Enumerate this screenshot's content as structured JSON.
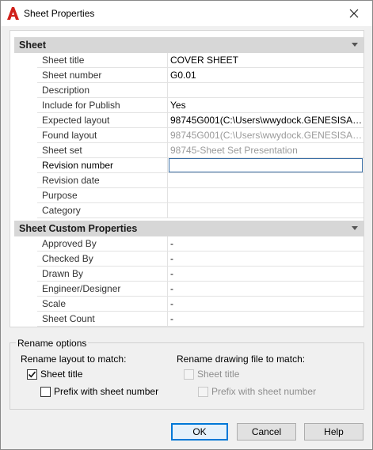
{
  "window": {
    "title": "Sheet Properties"
  },
  "sheet_section": {
    "header": "Sheet",
    "rows": [
      {
        "label": "Sheet title",
        "value": "COVER SHEET"
      },
      {
        "label": "Sheet number",
        "value": "G0.01"
      },
      {
        "label": "Description",
        "value": ""
      },
      {
        "label": "Include for Publish",
        "value": "Yes"
      },
      {
        "label": "Expected layout",
        "value": "98745G001(C:\\Users\\wwydock.GENESISAE..."
      },
      {
        "label": "Found layout",
        "value": "98745G001(C:\\Users\\wwydock.GENESISAE..."
      },
      {
        "label": "Sheet set",
        "value": "98745-Sheet Set Presentation"
      },
      {
        "label": "Revision number",
        "value": ""
      },
      {
        "label": "Revision date",
        "value": ""
      },
      {
        "label": "Purpose",
        "value": ""
      },
      {
        "label": "Category",
        "value": ""
      }
    ]
  },
  "custom_section": {
    "header": "Sheet Custom Properties",
    "rows": [
      {
        "label": "Approved By",
        "value": "-"
      },
      {
        "label": "Checked By",
        "value": "-"
      },
      {
        "label": "Drawn By",
        "value": "-"
      },
      {
        "label": "Engineer/Designer",
        "value": "-"
      },
      {
        "label": "Scale",
        "value": "-"
      },
      {
        "label": "Sheet Count",
        "value": "-"
      }
    ]
  },
  "rename": {
    "legend": "Rename options",
    "layout_heading": "Rename layout to match:",
    "layout_sheet_title": "Sheet title",
    "layout_prefix": "Prefix with sheet number",
    "drawing_heading": "Rename drawing file to match:",
    "drawing_sheet_title": "Sheet title",
    "drawing_prefix": "Prefix with sheet number"
  },
  "buttons": {
    "ok": "OK",
    "cancel": "Cancel",
    "help": "Help"
  },
  "colors": {
    "accent": "#0078d7",
    "app_icon": "#d0201a",
    "section_header": "#d7d7d7"
  }
}
